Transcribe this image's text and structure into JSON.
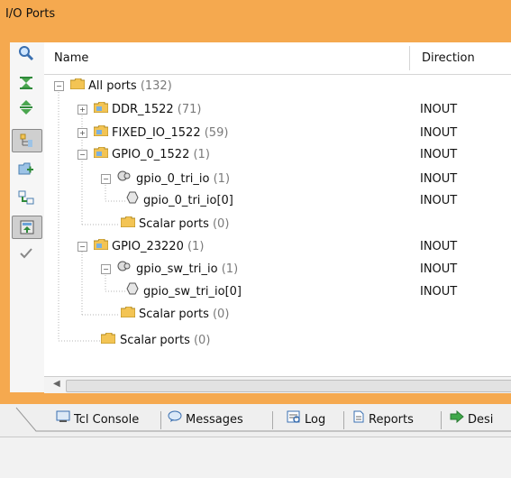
{
  "panel": {
    "title": "I/O Ports"
  },
  "columns": {
    "name": "Name",
    "direction": "Direction"
  },
  "rows": [
    {
      "label": "All ports",
      "count": "(132)",
      "direction": ""
    },
    {
      "label": "DDR_1522",
      "count": "(71)",
      "direction": "INOUT"
    },
    {
      "label": "FIXED_IO_1522",
      "count": "(59)",
      "direction": "INOUT"
    },
    {
      "label": "GPIO_0_1522",
      "count": "(1)",
      "direction": "INOUT"
    },
    {
      "label": "gpio_0_tri_io",
      "count": "(1)",
      "direction": "INOUT"
    },
    {
      "label": "gpio_0_tri_io[0]",
      "count": "",
      "direction": "INOUT"
    },
    {
      "label": "Scalar ports",
      "count": "(0)",
      "direction": ""
    },
    {
      "label": "GPIO_23220",
      "count": "(1)",
      "direction": "INOUT"
    },
    {
      "label": "gpio_sw_tri_io",
      "count": "(1)",
      "direction": "INOUT"
    },
    {
      "label": "gpio_sw_tri_io[0]",
      "count": "",
      "direction": "INOUT"
    },
    {
      "label": "Scalar ports",
      "count": "(0)",
      "direction": ""
    },
    {
      "label": "Scalar ports",
      "count": "(0)",
      "direction": ""
    }
  ],
  "tabs": [
    {
      "label": "Tcl Console",
      "icon": "console-icon"
    },
    {
      "label": "Messages",
      "icon": "speech-bubble-icon"
    },
    {
      "label": "Log",
      "icon": "log-icon"
    },
    {
      "label": "Reports",
      "icon": "report-icon"
    },
    {
      "label": "Desi",
      "icon": "green-arrow-icon"
    }
  ],
  "colors": {
    "panel": "#f5a94f",
    "folder": "#f3c454",
    "count": "#7a7a7a"
  }
}
